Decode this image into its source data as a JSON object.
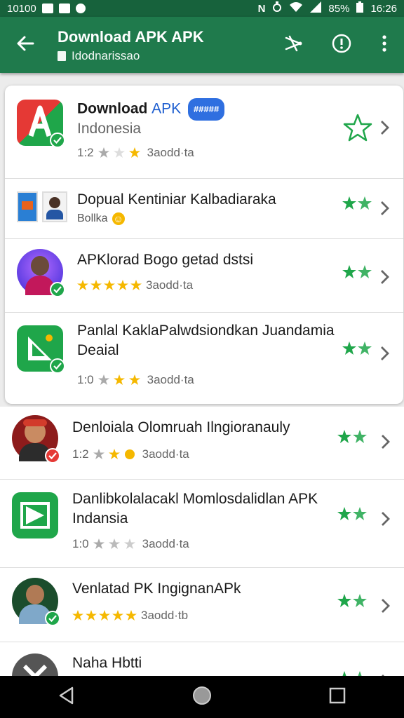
{
  "status_bar": {
    "time_left": "10100",
    "battery": "85%",
    "clock": "16:26",
    "network_letter": "N"
  },
  "app_bar": {
    "title": "Download APK APK",
    "subtitle": "Idodnarissao",
    "back_icon": "arrow-left-icon",
    "actions": [
      "share-icon",
      "info-icon",
      "more-vert-icon"
    ]
  },
  "featured": {
    "title_part1": "Download ",
    "title_part2": "APK",
    "badge": "#####",
    "subtitle": "Indonesia",
    "rating": "1:2",
    "meta": "3aodd·ta"
  },
  "card_rows": [
    {
      "title": "Dopual Kentiniar Kalbadiaraka",
      "sub": "Bollka",
      "emoji": "☺"
    },
    {
      "title": "APKlorad Bogo getad dstsi",
      "rating": "",
      "meta": "3aodd·ta"
    },
    {
      "title_line1": "Panlal KaklaPalwdsiondkan Juandamia",
      "title_line2": "Deaial",
      "rating": "1:0",
      "meta": "3aodd·ta"
    }
  ],
  "plain_rows": [
    {
      "title": "Denloiala Olomruah Ilngioranauly",
      "rating": "1:2",
      "meta": "3aodd·ta"
    },
    {
      "title_line1": "Danlibkolalacakl Momlosdalidlan APK",
      "title_line2": "Indansia",
      "rating": "1:0",
      "meta": "3aodd·ta"
    },
    {
      "title": "Venlatad PK IngignanAPk",
      "rating": "",
      "meta": "3aodd·tb"
    },
    {
      "title": "Naha Hbtti"
    }
  ],
  "colors": {
    "app_bar": "#1f7a4c",
    "status_bar": "#17623c",
    "accent_green": "#1fa64a",
    "star_yellow": "#f5b800",
    "badge_blue": "#2f6fe0",
    "badge_red": "#e53935"
  }
}
